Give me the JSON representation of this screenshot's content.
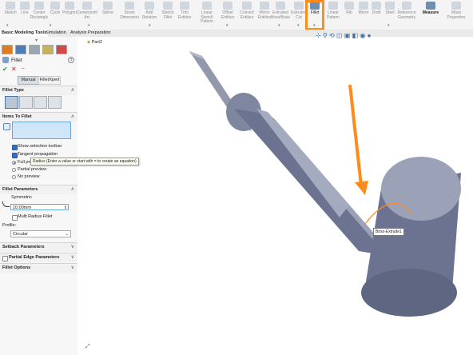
{
  "ribbon": {
    "tools": [
      "Sketch",
      "Line",
      "Center Rectangle",
      "Cycle",
      "Polygon",
      "Centerpoint Arc",
      "Spline",
      "Smart Dimension",
      "Add Relation",
      "Sketch Fillet",
      "Trim Entities",
      "Linear Sketch Pattern",
      "Offset Entities",
      "Convert Entities",
      "Mirror Entities",
      "Extruded Boss/Base",
      "Extruded Cut",
      "Fillet",
      "Linear Pattern",
      "Rib",
      "Mirror",
      "Draft",
      "Shell",
      "Reference Geometry",
      "Measure",
      "Mass Properties"
    ],
    "active_tool": "Fillet",
    "highlight_color": "#ff8c1a"
  },
  "command_tabs": [
    "Basic Modeling Tools",
    "Simulation",
    "Analysis Preparation"
  ],
  "panel": {
    "title": "Fillet",
    "help_icon": "?",
    "ok": "✔",
    "cancel": "✕",
    "pin": "⇔",
    "modes": [
      "Manual",
      "FilletXpert"
    ],
    "fillet_type": {
      "title": "Fillet Type"
    },
    "items_to_fillet": {
      "title": "Items To Fillet",
      "options": [
        {
          "label": "Show selection toolbar",
          "checked": true
        },
        {
          "label": "Tangent propagation",
          "checked": true
        }
      ],
      "preview": [
        {
          "label": "Full preview",
          "selected": true
        },
        {
          "label": "Partial preview",
          "selected": false
        },
        {
          "label": "No preview",
          "selected": false
        }
      ]
    },
    "fillet_parameters": {
      "title": "Fillet Parameters",
      "method": "Symmetric",
      "tooltip": "Radius (Enter a value or start with = to create an equation)",
      "radius_value": "10.00mm",
      "multi_radius_label": "Multi Radius Fillet",
      "profile_label": "Profile:",
      "profile_value": "Circular"
    },
    "setback": {
      "title": "Setback Parameters"
    },
    "partial_edge": {
      "title": "Partial Edge Parameters"
    },
    "options": {
      "title": "Fillet Options"
    }
  },
  "viewport": {
    "tree_item": "Part2",
    "edge_tag": "Boss-Extrude1",
    "arrow_color": "#ff8c1a",
    "model_color": "#6b7390"
  }
}
